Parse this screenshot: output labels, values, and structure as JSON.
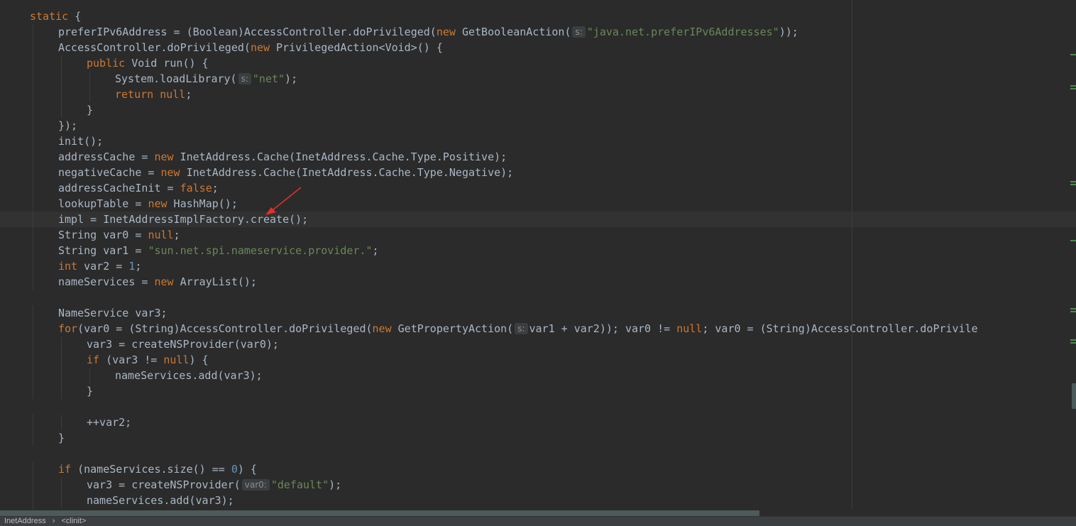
{
  "editor": {
    "lines": [
      {
        "indent": 1,
        "tokens": [
          [
            "kw",
            "static"
          ],
          [
            "p",
            " {"
          ]
        ]
      },
      {
        "indent": 2,
        "tokens": [
          [
            "p",
            "preferIPv6Address = (Boolean)AccessController.doPrivileged("
          ],
          [
            "kw",
            "new"
          ],
          [
            "p",
            " GetBooleanAction("
          ],
          [
            "hint",
            "s:"
          ],
          [
            "str",
            "\"java.net.preferIPv6Addresses\""
          ],
          [
            "p",
            "));"
          ]
        ]
      },
      {
        "indent": 2,
        "tokens": [
          [
            "p",
            "AccessController.doPrivileged("
          ],
          [
            "kw",
            "new"
          ],
          [
            "p",
            " PrivilegedAction<Void>() {"
          ]
        ]
      },
      {
        "indent": 3,
        "tokens": [
          [
            "kw",
            "public"
          ],
          [
            "p",
            " Void run() {"
          ]
        ]
      },
      {
        "indent": 4,
        "tokens": [
          [
            "p",
            "System.loadLibrary("
          ],
          [
            "hint",
            "s:"
          ],
          [
            "str",
            "\"net\""
          ],
          [
            "p",
            ");"
          ]
        ]
      },
      {
        "indent": 4,
        "tokens": [
          [
            "kw",
            "return null"
          ],
          [
            "p",
            ";"
          ]
        ]
      },
      {
        "indent": 3,
        "tokens": [
          [
            "p",
            "}"
          ]
        ]
      },
      {
        "indent": 2,
        "tokens": [
          [
            "p",
            "});"
          ]
        ]
      },
      {
        "indent": 2,
        "tokens": [
          [
            "p",
            "init();"
          ]
        ]
      },
      {
        "indent": 2,
        "tokens": [
          [
            "p",
            "addressCache = "
          ],
          [
            "kw",
            "new"
          ],
          [
            "p",
            " InetAddress.Cache(InetAddress.Cache.Type.Positive);"
          ]
        ]
      },
      {
        "indent": 2,
        "tokens": [
          [
            "p",
            "negativeCache = "
          ],
          [
            "kw",
            "new"
          ],
          [
            "p",
            " InetAddress.Cache(InetAddress.Cache.Type.Negative);"
          ]
        ]
      },
      {
        "indent": 2,
        "tokens": [
          [
            "p",
            "addressCacheInit = "
          ],
          [
            "kw",
            "false"
          ],
          [
            "p",
            ";"
          ]
        ]
      },
      {
        "indent": 2,
        "tokens": [
          [
            "p",
            "lookupTable = "
          ],
          [
            "kw",
            "new"
          ],
          [
            "p",
            " HashMap();"
          ]
        ]
      },
      {
        "indent": 2,
        "current": true,
        "tokens": [
          [
            "p",
            "impl = InetAddressImplFactory.create();"
          ]
        ]
      },
      {
        "indent": 2,
        "tokens": [
          [
            "p",
            "String var0 = "
          ],
          [
            "kw",
            "null"
          ],
          [
            "p",
            ";"
          ]
        ]
      },
      {
        "indent": 2,
        "tokens": [
          [
            "p",
            "String var1 = "
          ],
          [
            "str",
            "\"sun.net.spi.nameservice.provider.\""
          ],
          [
            "p",
            ";"
          ]
        ]
      },
      {
        "indent": 2,
        "tokens": [
          [
            "kw",
            "int"
          ],
          [
            "p",
            " var2 = "
          ],
          [
            "num",
            "1"
          ],
          [
            "p",
            ";"
          ]
        ]
      },
      {
        "indent": 2,
        "tokens": [
          [
            "p",
            "nameServices = "
          ],
          [
            "kw",
            "new"
          ],
          [
            "p",
            " ArrayList();"
          ]
        ]
      },
      {
        "indent": 0,
        "tokens": []
      },
      {
        "indent": 2,
        "tokens": [
          [
            "p",
            "NameService var3;"
          ]
        ]
      },
      {
        "indent": 2,
        "tokens": [
          [
            "kw",
            "for"
          ],
          [
            "p",
            "(var0 = (String)AccessController.doPrivileged("
          ],
          [
            "kw",
            "new"
          ],
          [
            "p",
            " GetPropertyAction("
          ],
          [
            "hint",
            "s:"
          ],
          [
            "p",
            "var1 + var2)); var0 != "
          ],
          [
            "kw",
            "null"
          ],
          [
            "p",
            "; var0 = (String)AccessController.doPrivile"
          ]
        ]
      },
      {
        "indent": 3,
        "tokens": [
          [
            "p",
            "var3 = createNSProvider(var0);"
          ]
        ]
      },
      {
        "indent": 3,
        "tokens": [
          [
            "kw",
            "if"
          ],
          [
            "p",
            " (var3 != "
          ],
          [
            "kw",
            "null"
          ],
          [
            "p",
            ") {"
          ]
        ]
      },
      {
        "indent": 4,
        "tokens": [
          [
            "p",
            "nameServices.add(var3);"
          ]
        ]
      },
      {
        "indent": 3,
        "tokens": [
          [
            "p",
            "}"
          ]
        ]
      },
      {
        "indent": 0,
        "tokens": []
      },
      {
        "indent": 3,
        "tokens": [
          [
            "p",
            "++var2;"
          ]
        ]
      },
      {
        "indent": 2,
        "tokens": [
          [
            "p",
            "}"
          ]
        ]
      },
      {
        "indent": 0,
        "tokens": []
      },
      {
        "indent": 2,
        "tokens": [
          [
            "kw",
            "if"
          ],
          [
            "p",
            " (nameServices.size() == "
          ],
          [
            "num",
            "0"
          ],
          [
            "p",
            ") {"
          ]
        ]
      },
      {
        "indent": 3,
        "tokens": [
          [
            "p",
            "var3 = createNSProvider("
          ],
          [
            "hint",
            "var0:"
          ],
          [
            "str",
            "\"default\""
          ],
          [
            "p",
            ");"
          ]
        ]
      },
      {
        "indent": 3,
        "tokens": [
          [
            "p",
            "nameServices.add(var3);"
          ]
        ]
      },
      {
        "indent": 2,
        "tokens": [
          [
            "p",
            "}"
          ]
        ]
      }
    ]
  },
  "breadcrumb": [
    "InetAddress",
    "<clinit>"
  ],
  "colors": {
    "background": "#2b2b2b",
    "current_line": "#323232",
    "keyword": "#cc7832",
    "string": "#6a8759",
    "number": "#6897bb",
    "plain": "#a9b7c6",
    "annotation_arrow": "#e0302a"
  }
}
